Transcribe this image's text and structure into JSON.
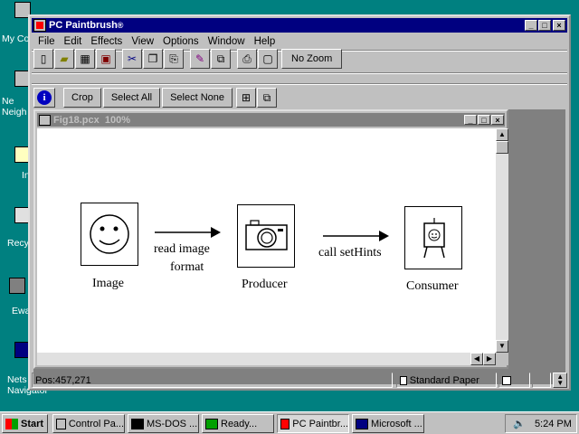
{
  "desktop": {
    "icons": [
      "My Co",
      "Ne Neigh",
      "In",
      "Recy",
      "Ewa",
      "Nets Navigator"
    ]
  },
  "app": {
    "title": "PC Paintbrush",
    "title_mark": "®",
    "menu": [
      "File",
      "Edit",
      "Effects",
      "View",
      "Options",
      "Window",
      "Help"
    ],
    "toolbar": {
      "zoom_label": "No Zoom"
    },
    "toolbar2": {
      "crop": "Crop",
      "select_all": "Select All",
      "select_none": "Select None"
    },
    "document": {
      "title": "Fig18.pcx  100%",
      "figure": {
        "image_label": "Image",
        "producer_label": "Producer",
        "consumer_label": "Consumer",
        "arrow1_line1": "read image",
        "arrow1_line2": "format",
        "arrow2_label": "call setHints"
      }
    },
    "status": {
      "position": "Pos:457,271",
      "paper": "Standard Paper"
    }
  },
  "taskbar": {
    "start": "Start",
    "items": [
      "Control Pa...",
      "MS-DOS ...",
      "Ready...",
      "PC Paintbr...",
      "Microsoft ..."
    ],
    "clock": "5:24 PM"
  }
}
